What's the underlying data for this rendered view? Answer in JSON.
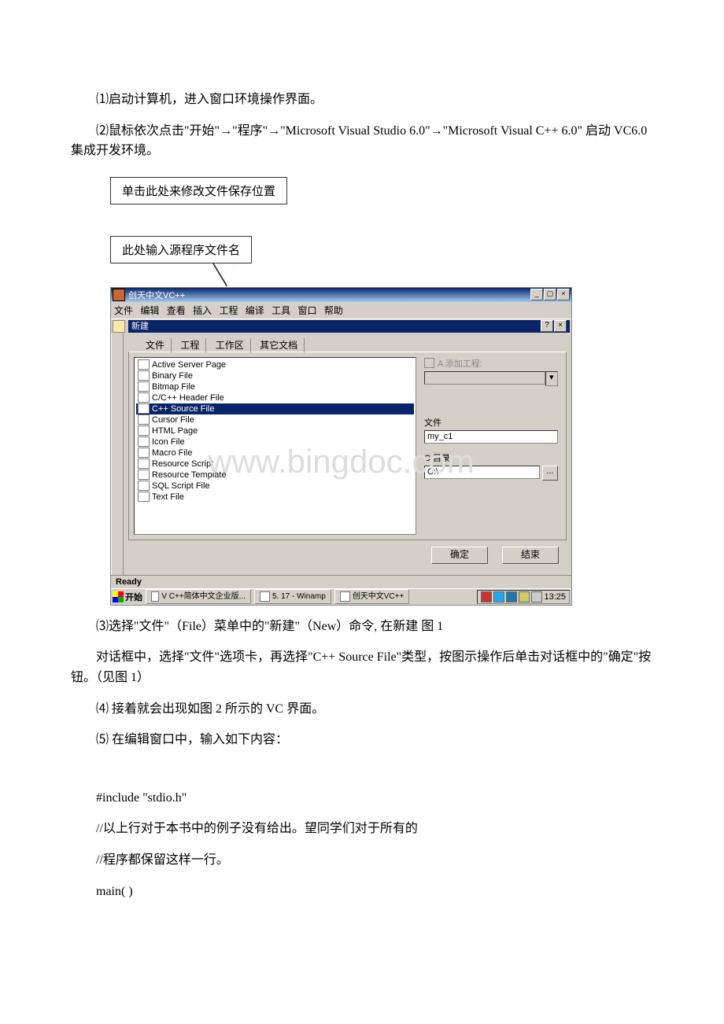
{
  "paragraphs": {
    "p1": "⑴启动计算机，进入窗口环境操作界面。",
    "p2": "⑵鼠标依次点击\"开始\"→\"程序\"→\"Microsoft Visual Studio 6.0\"→\"Microsoft Visual C++ 6.0\" 启动 VC6.0 集成开发环境。",
    "p3": "⑶选择\"文件\"（File）菜单中的\"新建\"（New）命令, 在新建 图 1",
    "p4": "对话框中，选择\"文件\"选项卡，再选择\"C++ Source File\"类型，按图示操作后单击对话框中的\"确定\"按钮。（见图 1）",
    "p5": "⑷ 接着就会出现如图 2 所示的 VC 界面。",
    "p6": "⑸ 在编辑窗口中，输入如下内容：",
    "code1": "#include \"stdio.h\"",
    "code2": "//以上行对于本书中的例子没有给出。望同学们对于所有的",
    "code3": "//程序都保留这样一行。",
    "code4": "main( )"
  },
  "callouts": {
    "c1": "单击此处来修改文件保存位置",
    "c2": "此处输入源程序文件名"
  },
  "screenshot": {
    "window_title": "创天中文VC++",
    "menu": [
      "文件",
      "编辑",
      "查看",
      "插入",
      "工程",
      "编译",
      "工具",
      "窗口",
      "帮助"
    ],
    "dialog_title": "新建",
    "tabs": [
      "文件",
      "工程",
      "工作区",
      "其它文档"
    ],
    "file_list": [
      "Active Server Page",
      "Binary File",
      "Bitmap File",
      "C/C++ Header File",
      "C++ Source File",
      "Cursor File",
      "HTML Page",
      "Icon File",
      "Macro File",
      "Resource Script",
      "Resource Template",
      "SQL Script File",
      "Text File"
    ],
    "selected_file_index": 4,
    "add_to_project_label": "A 添加工程:",
    "file_label": "文件",
    "file_value": "my_c1",
    "dir_label": "C 目录:",
    "dir_value": "C:\\",
    "browse_button": "...",
    "ok_button": "确定",
    "end_button": "结束",
    "status": "Ready",
    "taskbar": {
      "start": "开始",
      "items": [
        "V C++简体中文企业版...",
        "5. 17 - Winamp",
        "创天中文VC++"
      ],
      "time": "13:25"
    }
  },
  "watermark": "www.bingdoc.com"
}
